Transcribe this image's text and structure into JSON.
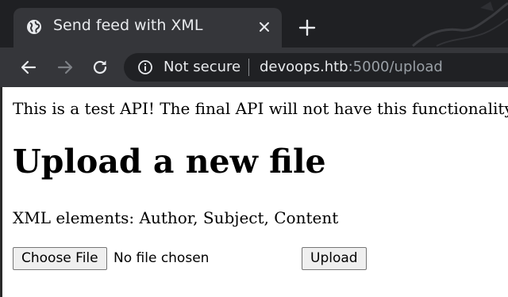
{
  "browser": {
    "tab": {
      "title": "Send feed with XML",
      "favicon": "globe-icon",
      "close_icon": "close-icon"
    },
    "new_tab_icon": "plus-icon",
    "toolbar": {
      "back_icon": "arrow-left-icon",
      "forward_icon": "arrow-right-icon",
      "reload_icon": "reload-icon",
      "security_icon": "info-icon",
      "security_label": "Not secure",
      "url_host": "devoops.htb",
      "url_rest": ":5000/upload"
    },
    "colors": {
      "tabstrip": "#1f2023",
      "toolbar": "#35363a",
      "omnibox": "#202124",
      "text": "#e8eaed",
      "muted": "#9aa0a6"
    }
  },
  "page": {
    "notice": "This is a test API! The final API will not have this functionality.",
    "heading": "Upload a new file",
    "elements_note": "XML elements: Author, Subject, Content",
    "file_input": {
      "button_label": "Choose File",
      "status": "No file chosen"
    },
    "submit_label": "Upload"
  }
}
